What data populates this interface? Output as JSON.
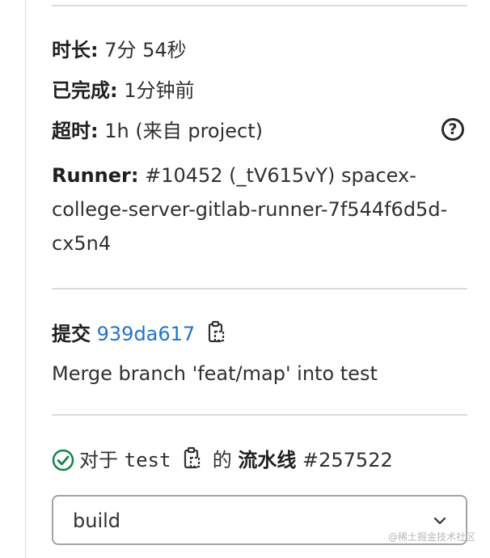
{
  "details": {
    "duration": {
      "label": "时长:",
      "value": "7分 54秒"
    },
    "finished": {
      "label": "已完成:",
      "value": "1分钟前"
    },
    "timeout": {
      "label": "超时:",
      "value": "1h (来自 project)"
    },
    "runner": {
      "label": "Runner:",
      "value": "#10452 (_tV615vY) spacex-college-server-gitlab-runner-7f544f6d5d-cx5n4"
    }
  },
  "commit": {
    "label": "提交",
    "sha": "939da617",
    "message": "Merge branch 'feat/map' into test"
  },
  "pipeline": {
    "prefix": "对于",
    "ref": "test",
    "middle": "的",
    "label": "流水线",
    "id": "#257522"
  },
  "stage_select": {
    "value": "build"
  },
  "watermark": "@稀土掘金技术社区",
  "colors": {
    "link": "#1f75cb",
    "success": "#108548",
    "border": "#dcdcde"
  },
  "icons": [
    "help-icon",
    "copy-icon",
    "status-success-icon",
    "chevron-down-icon"
  ]
}
